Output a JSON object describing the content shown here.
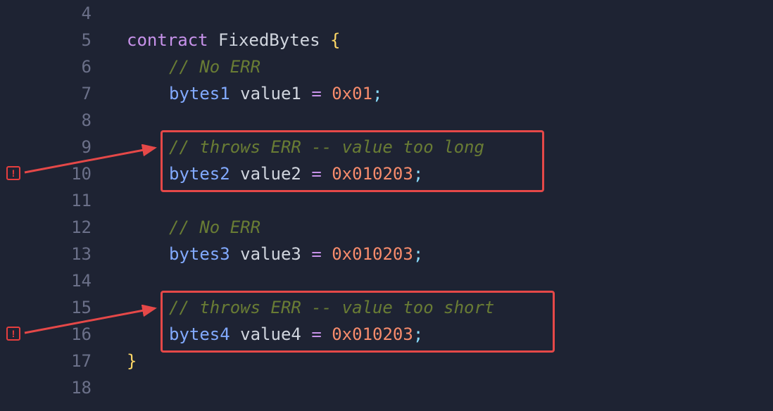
{
  "lines": [
    {
      "num": "4"
    },
    {
      "num": "5"
    },
    {
      "num": "6"
    },
    {
      "num": "7"
    },
    {
      "num": "8"
    },
    {
      "num": "9"
    },
    {
      "num": "10"
    },
    {
      "num": "11"
    },
    {
      "num": "12"
    },
    {
      "num": "13"
    },
    {
      "num": "14"
    },
    {
      "num": "15"
    },
    {
      "num": "16"
    },
    {
      "num": "17"
    },
    {
      "num": "18"
    }
  ],
  "code": {
    "line5_keyword": "contract",
    "line5_name": "FixedBytes",
    "line5_brace": "{",
    "line6_comment": "// No ERR",
    "line7_type": "bytes1",
    "line7_var": "value1",
    "line7_eq": "=",
    "line7_val": "0x01",
    "line7_semi": ";",
    "line9_comment": "// throws ERR -- value too long",
    "line10_type": "bytes2",
    "line10_var": "value2",
    "line10_eq": "=",
    "line10_val": "0x010203",
    "line10_semi": ";",
    "line12_comment": "// No ERR",
    "line13_type": "bytes3",
    "line13_var": "value3",
    "line13_eq": "=",
    "line13_val": "0x010203",
    "line13_semi": ";",
    "line15_comment": "// throws ERR -- value too short",
    "line16_type": "bytes4",
    "line16_var": "value4",
    "line16_eq": "=",
    "line16_val": "0x010203",
    "line16_semi": ";",
    "line17_brace": "}"
  },
  "error_badge": "!"
}
